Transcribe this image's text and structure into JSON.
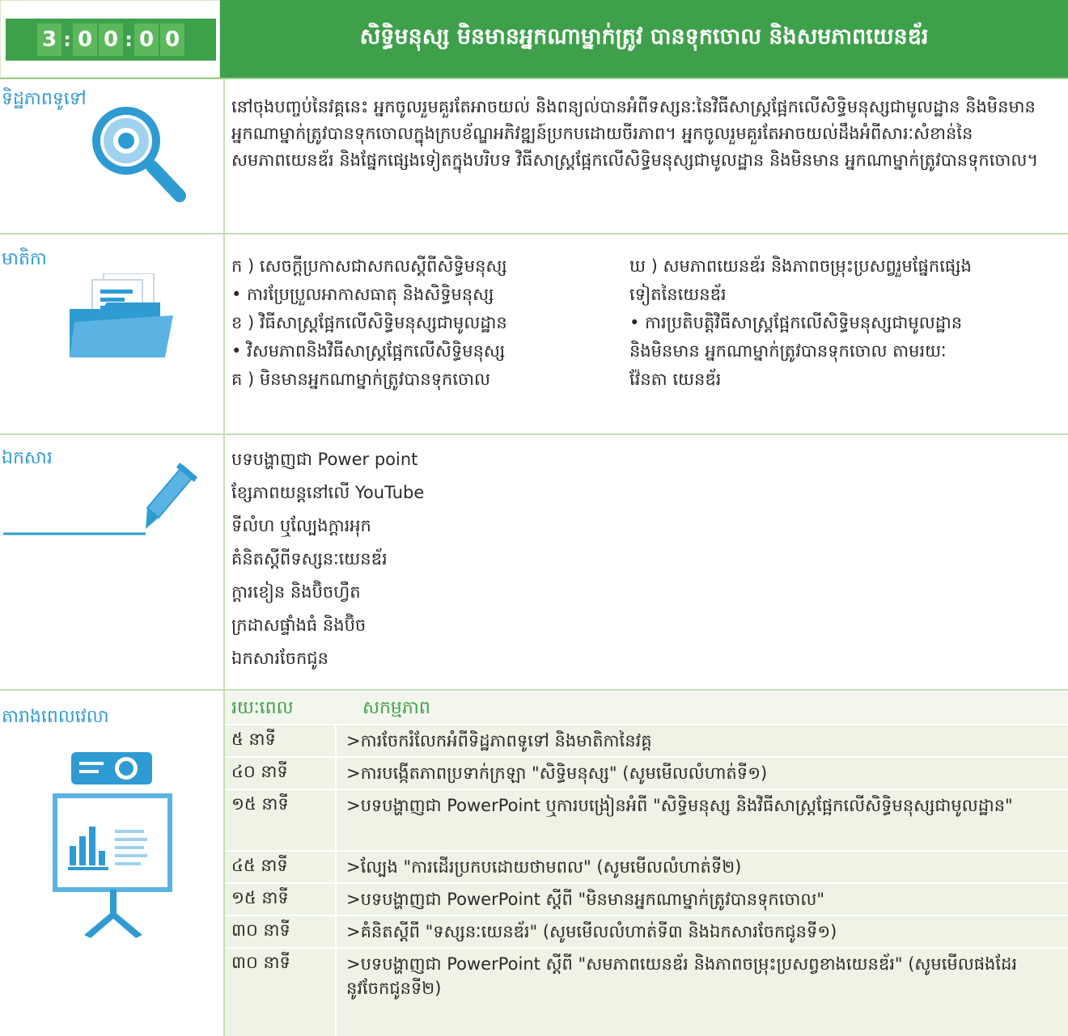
{
  "header": {
    "timer_digits": [
      "3",
      "0",
      "0",
      "0",
      "0"
    ],
    "title": "សិទ្ធិមនុស្ស មិនមានអ្នកណាម្នាក់ត្រូវ បានទុកចោល និងសមភាពយេនឌ័រ"
  },
  "objectives": {
    "label": "ទិដ្ឋភាពទូទៅ",
    "text": "នៅចុងបញ្ចប់នៃវគ្គនេះ អ្នកចូលរួមគួរតែអាចយល់ និងពន្យល់បានអំពីទស្សនៈនៃវិធីសាស្ត្រផ្អែកលើសិទ្ធិមនុស្សជាមូលដ្ឋាន និងមិនមានអ្នកណាម្នាក់ត្រូវបានទុកចោលក្នុងក្របខ័ណ្ឌអភិវឌ្ឍន៍ប្រកបដោយចីរភាព។ អ្នកចូលរួមគួរតែអាចយល់ដឹងអំពីសារៈសំខាន់នៃសមភាពយេនឌ័រ និងផ្នែកផ្សេងទៀតក្នុងបរិបទ វិធីសាស្ត្រផ្អែកលើសិទ្ធិមនុស្សជាមូលដ្ឋាន និងមិនមាន អ្នកណាម្នាក់ត្រូវបានទុកចោល។"
  },
  "contents": {
    "label": "មាតិកា",
    "left": [
      "ក ) សេចក្តីប្រកាសជាសកលស្តីពីសិទ្ធិមនុស្ស",
      "• ការប្រែប្រួលអាកាសធាតុ និងសិទ្ធិមនុស្ស",
      "ខ ) វិធីសាស្ត្រផ្អែកលើសិទ្ធិមនុស្សជាមូលដ្ឋាន",
      "• វិសមភាពនិងវិធីសាស្ត្រផ្អែកលើសិទ្ធិមនុស្ស",
      "គ ) មិនមានអ្នកណាម្នាក់ត្រូវបានទុកចោល"
    ],
    "right": [
      "ឃ ) សមភាពយេនឌ័រ និងភាពចម្រុះប្រសព្វរួមផ្នែកផ្សេង",
      "ទៀតនៃយេនឌ័រ",
      "• ការប្រតិបត្តិវិធីសាស្ត្រផ្អែកលើសិទ្ធិមនុស្សជាមូលដ្ឋាន",
      "និងមិនមាន អ្នកណាម្នាក់ត្រូវបានទុកចោល តាមរយៈ",
      "វ៉ែនតា យេនឌ័រ"
    ]
  },
  "materials": {
    "label": "ឯកសារ",
    "items": [
      "បទបង្ហាញជា Power point",
      "ខ្សែភាពយន្តនៅលើ YouTube",
      "ទីលំហ ឬល្បែងក្តារអុក",
      "គំនិតស្តីពីទស្សនៈយេនឌ័រ",
      "ក្តារខៀន និងប៊ិចហ្វឺត",
      "ក្រដាសផ្ទាំងធំ និងប៊ិច",
      "ឯកសារចែកជូន"
    ]
  },
  "schedule": {
    "label": "តារាងពេលវេលា",
    "col_duration": "រយៈពេល",
    "col_activity": "សកម្មភាព",
    "rows": [
      {
        "duration": "៥ នាទី",
        "activity": ">ការចែករំលែកអំពីទិដ្ឋភាពទូទៅ និងមាតិកានៃវគ្គ"
      },
      {
        "duration": "៤០ នាទី",
        "activity": ">ការបង្កើតភាពប្រទាក់ក្រឡា \"សិទ្ធិមនុស្ស\" (សូមមើលលំហាត់ទី១)"
      },
      {
        "duration": "១៥ នាទី",
        "activity": ">បទបង្ហាញជា PowerPoint ឬការបង្រៀនអំពី \"សិទ្ធិមនុស្ស និងវិធីសាស្ត្រផ្អែកលើសិទ្ធិមនុស្សជាមូលដ្ឋាន\""
      },
      {
        "duration": "៤៥ នាទី",
        "activity": ">ល្បែង \"ការដើរប្រកបដោយថាមពល\" (សូមមើលលំហាត់ទី២)"
      },
      {
        "duration": "១៥ នាទី",
        "activity": ">បទបង្ហាញជា PowerPoint ស្តីពី \"មិនមានអ្នកណាម្នាក់ត្រូវបានទុកចោល\""
      },
      {
        "duration": "៣០ នាទី",
        "activity": ">គំនិតស្តីពី \"ទស្សនៈយេនឌ័រ\" (សូមមើលលំហាត់ទី៣ និងឯកសារចែកជូនទី១)"
      },
      {
        "duration": "៣០ នាទី",
        "activity": ">បទបង្ហាញជា PowerPoint ស្តីពី \"សមភាពយេនឌ័រ និងភាពចម្រុះប្រសព្វខាងយេនឌ័រ\" (សូមមើលផងដែរនូវចែកជូនទី២)"
      }
    ]
  },
  "colors": {
    "brand_green": "#3fa04b",
    "label_blue": "#2f9bd3",
    "table_bg": "#eef3e6"
  },
  "icons": [
    "magnifier-icon",
    "folder-icon",
    "pen-icon",
    "projector-icon"
  ]
}
